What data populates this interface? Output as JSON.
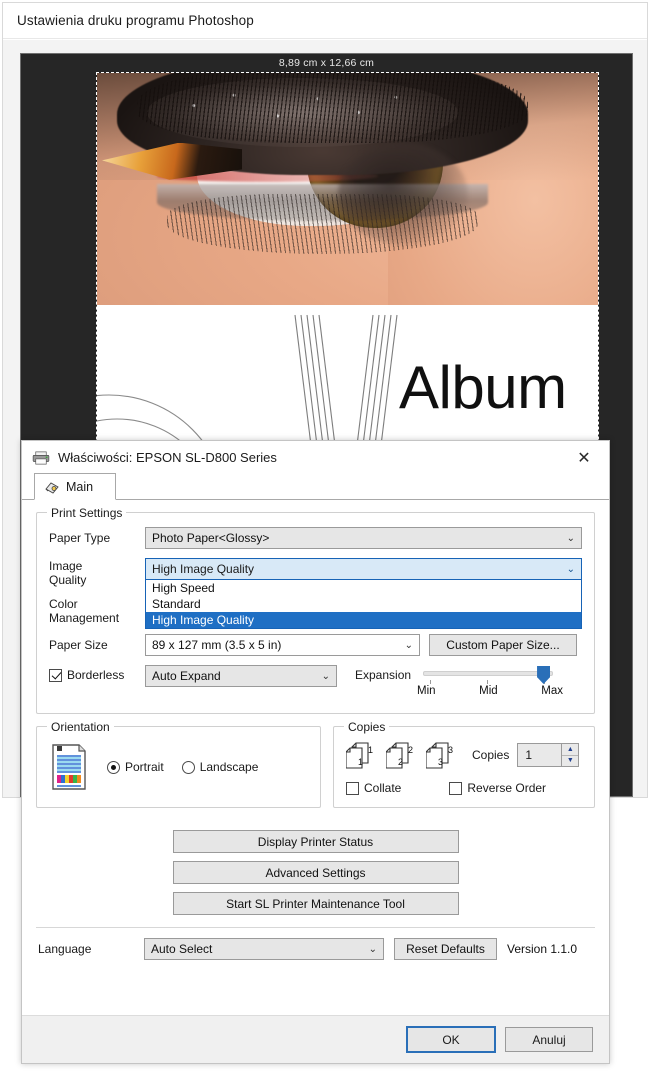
{
  "host_window": {
    "title": "Ustawienia druku programu Photoshop",
    "preview": {
      "dimensions_label": "8,89 cm x 12,66 cm",
      "album_text": "Album",
      "photo_description": "close-up-eye-with-makeup-brush"
    }
  },
  "dialog": {
    "title": "Właściwości: EPSON SL-D800 Series",
    "close_glyph": "✕",
    "printer_icon": "printer-icon",
    "tabs": [
      {
        "label": "Main",
        "icon": "printer-tab-icon",
        "active": true
      }
    ],
    "print_settings": {
      "group_title": "Print Settings",
      "paper_type": {
        "label": "Paper Type",
        "value": "Photo Paper<Glossy>"
      },
      "image_quality": {
        "label": "Image\nQuality",
        "label_line1": "Image",
        "label_line2": "Quality",
        "value": "High Image Quality",
        "expanded": true,
        "options": [
          {
            "label": "High Speed",
            "selected": false
          },
          {
            "label": "Standard",
            "selected": false
          },
          {
            "label": "High Image Quality",
            "selected": true
          }
        ]
      },
      "color_management": {
        "label_line1": "Color",
        "label_line2": "Management"
      },
      "paper_size": {
        "label": "Paper Size",
        "value": "89 x 127 mm (3.5 x 5 in)",
        "custom_button": "Custom Paper Size..."
      },
      "borderless": {
        "label": "Borderless",
        "checked": true,
        "mode_value": "Auto Expand"
      },
      "expansion": {
        "label": "Expansion",
        "ticks": [
          "Min",
          "Mid",
          "Max"
        ],
        "position": "Max",
        "value_percent": 100
      }
    },
    "orientation": {
      "group_title": "Orientation",
      "icon": "document-orientation-icon",
      "options": [
        {
          "label": "Portrait",
          "selected": true
        },
        {
          "label": "Landscape",
          "selected": false
        }
      ]
    },
    "copies": {
      "group_title": "Copies",
      "icon_labels": [
        "1",
        "2",
        "3"
      ],
      "copies_label": "Copies",
      "copies_value": "1",
      "collate": {
        "label": "Collate",
        "checked": false
      },
      "reverse_order": {
        "label": "Reverse Order",
        "checked": false
      }
    },
    "actions": [
      {
        "label": "Display Printer Status"
      },
      {
        "label": "Advanced Settings"
      },
      {
        "label": "Start SL Printer Maintenance Tool"
      }
    ],
    "language": {
      "label": "Language",
      "value": "Auto Select"
    },
    "reset_button": "Reset Defaults",
    "version": "Version 1.1.0",
    "footer": {
      "ok": "OK",
      "cancel": "Anuluj"
    }
  },
  "colors": {
    "accent_blue": "#1f6fc4",
    "combo_border_focus": "#1763b6",
    "combo_bg": "#e6e6e6",
    "dialog_bg": "#ffffff",
    "canvas_dark": "#262626",
    "slider_thumb": "#2a6fb8"
  }
}
